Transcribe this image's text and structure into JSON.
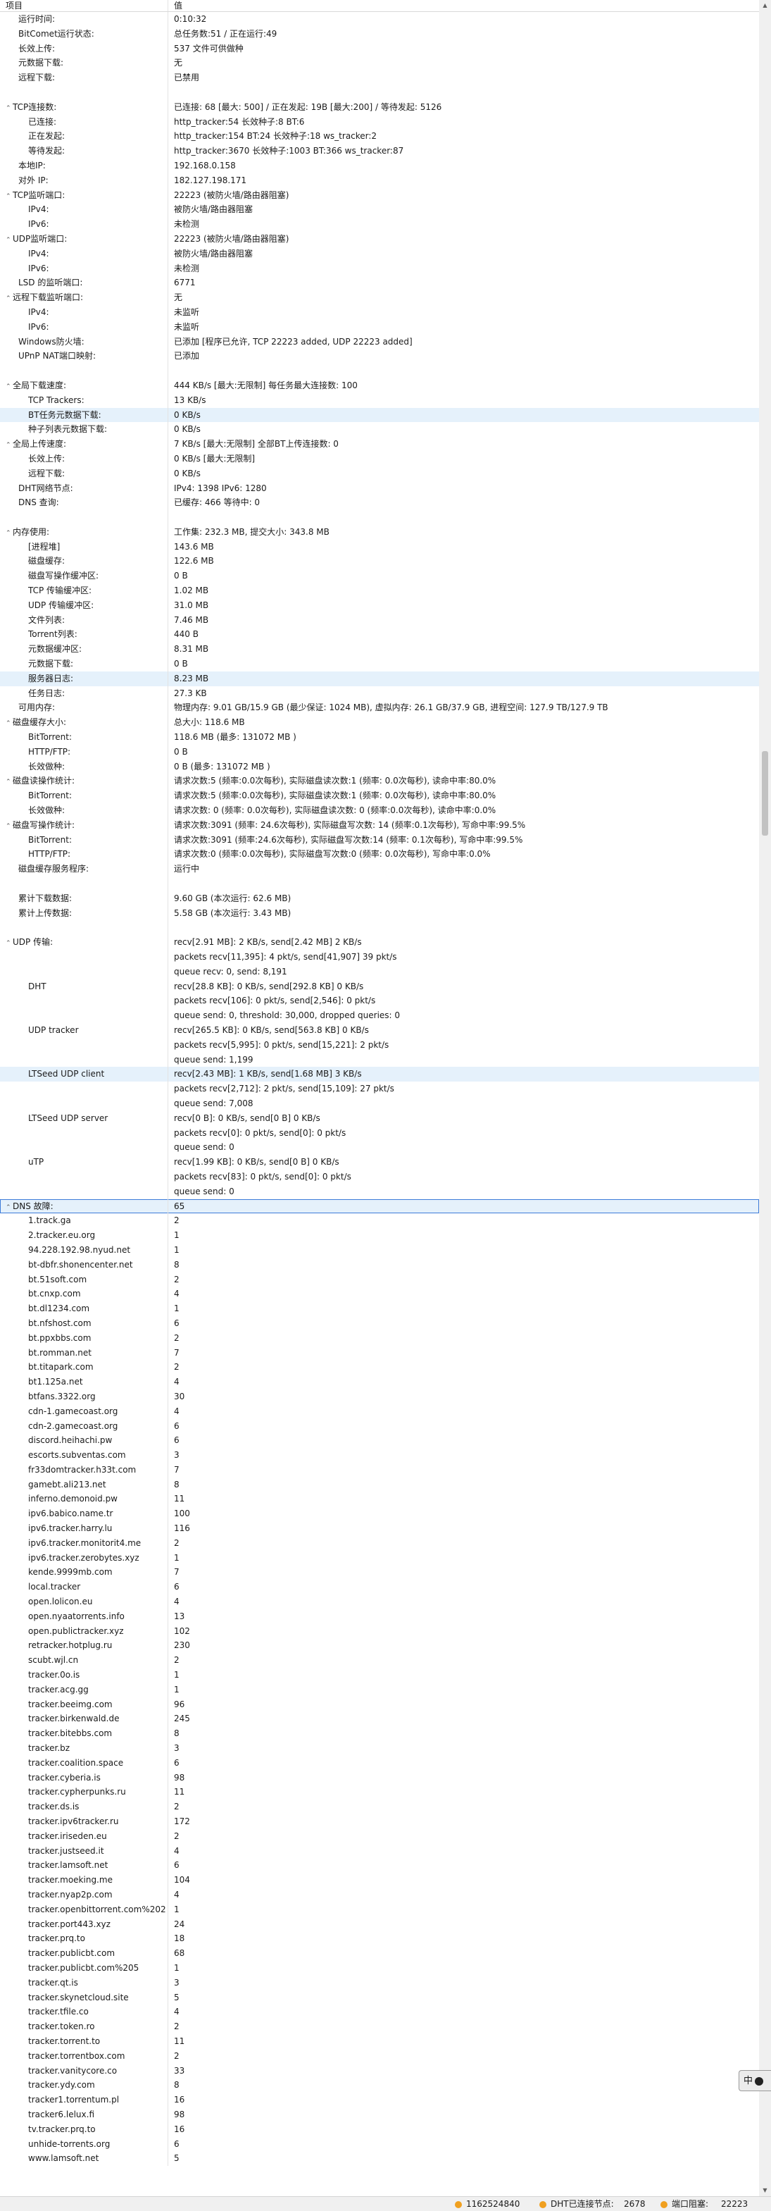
{
  "header": {
    "col_item": "项目",
    "col_value": "值"
  },
  "rows": [
    {
      "k": "运行时间:",
      "v": "0:10:32",
      "i": 1
    },
    {
      "k": "BitComet运行状态:",
      "v": "总任务数:51 / 正在运行:49",
      "i": 1
    },
    {
      "k": "长效上传:",
      "v": "537 文件可供做种",
      "i": 1
    },
    {
      "k": "元数据下载:",
      "v": "无",
      "i": 1
    },
    {
      "k": "远程下载:",
      "v": "已禁用",
      "i": 1
    },
    {
      "k": "",
      "v": ""
    },
    {
      "k": "TCP连接数:",
      "v": "已连接: 68 [最大: 500] / 正在发起: 19B [最大:200] / 等待发起: 5126",
      "t": "^"
    },
    {
      "k": "已连接:",
      "v": "http_tracker:54  长效种子:8  BT:6",
      "i": 2
    },
    {
      "k": "正在发起:",
      "v": "http_tracker:154  BT:24  长效种子:18  ws_tracker:2",
      "i": 2
    },
    {
      "k": "等待发起:",
      "v": "http_tracker:3670  长效种子:1003  BT:366  ws_tracker:87",
      "i": 2
    },
    {
      "k": "本地IP:",
      "v": "192.168.0.158",
      "i": 1
    },
    {
      "k": "对外 IP:",
      "v": "182.127.198.171",
      "i": 1
    },
    {
      "k": "TCP监听端口:",
      "v": "22223 (被防火墙/路由器阻塞)",
      "t": "^"
    },
    {
      "k": "IPv4:",
      "v": "被防火墙/路由器阻塞",
      "i": 2
    },
    {
      "k": "IPv6:",
      "v": "未检测",
      "i": 2
    },
    {
      "k": "UDP监听端口:",
      "v": "22223 (被防火墙/路由器阻塞)",
      "t": "^"
    },
    {
      "k": "IPv4:",
      "v": "被防火墙/路由器阻塞",
      "i": 2
    },
    {
      "k": "IPv6:",
      "v": "未检测",
      "i": 2
    },
    {
      "k": "LSD 的监听端口:",
      "v": "6771",
      "i": 1
    },
    {
      "k": "远程下载监听端口:",
      "v": "无",
      "t": "^"
    },
    {
      "k": "IPv4:",
      "v": "未监听",
      "i": 2
    },
    {
      "k": "IPv6:",
      "v": "未监听",
      "i": 2
    },
    {
      "k": "Windows防火墙:",
      "v": "已添加 [程序已允许, TCP 22223 added, UDP 22223 added]",
      "i": 1
    },
    {
      "k": "UPnP NAT端口映射:",
      "v": "已添加",
      "i": 1
    },
    {
      "k": "",
      "v": ""
    },
    {
      "k": "全局下载速度:",
      "v": "444 KB/s [最大:无限制]      每任务最大连接数: 100",
      "t": "^"
    },
    {
      "k": "TCP Trackers:",
      "v": "13 KB/s",
      "i": 2
    },
    {
      "k": "BT任务元数据下载:",
      "v": "0 KB/s",
      "i": 2,
      "hl": 1
    },
    {
      "k": "种子列表元数据下载:",
      "v": "0 KB/s",
      "i": 2
    },
    {
      "k": "全局上传速度:",
      "v": "7 KB/s [最大:无限制]      全部BT上传连接数: 0",
      "t": "^"
    },
    {
      "k": "长效上传:",
      "v": "0 KB/s [最大:无限制]",
      "i": 2
    },
    {
      "k": "远程下载:",
      "v": "0 KB/s",
      "i": 2
    },
    {
      "k": "DHT网络节点:",
      "v": "IPv4: 1398  IPv6: 1280",
      "i": 1
    },
    {
      "k": "DNS 查询:",
      "v": "已缓存:   466    等待中:   0",
      "i": 1
    },
    {
      "k": "",
      "v": ""
    },
    {
      "k": "内存使用:",
      "v": "工作集: 232.3 MB, 提交大小: 343.8 MB",
      "t": "^"
    },
    {
      "k": "[进程堆]",
      "v": "143.6 MB",
      "i": 2
    },
    {
      "k": "磁盘缓存:",
      "v": "122.6 MB",
      "i": 2
    },
    {
      "k": "磁盘写操作缓冲区:",
      "v": "0 B",
      "i": 2
    },
    {
      "k": "TCP 传输缓冲区:",
      "v": "1.02 MB",
      "i": 2
    },
    {
      "k": "UDP 传输缓冲区:",
      "v": "31.0 MB",
      "i": 2
    },
    {
      "k": "文件列表:",
      "v": "7.46 MB",
      "i": 2
    },
    {
      "k": "Torrent列表:",
      "v": "440 B",
      "i": 2
    },
    {
      "k": "元数据缓冲区:",
      "v": "8.31 MB",
      "i": 2
    },
    {
      "k": "元数据下载:",
      "v": "0 B",
      "i": 2
    },
    {
      "k": "服务器日志:",
      "v": "8.23 MB",
      "i": 2,
      "hl": 1
    },
    {
      "k": "任务日志:",
      "v": "27.3 KB",
      "i": 2
    },
    {
      "k": "可用内存:",
      "v": "物理内存: 9.01 GB/15.9 GB (最少保证: 1024 MB), 虚拟内存: 26.1 GB/37.9 GB, 进程空间: 127.9 TB/127.9 TB",
      "i": 1
    },
    {
      "k": "磁盘缓存大小:",
      "v": "总大小: 118.6 MB",
      "t": "^"
    },
    {
      "k": "BitTorrent:",
      "v": "118.6 MB (最多: 131072 MB )",
      "i": 2
    },
    {
      "k": "HTTP/FTP:",
      "v": "0 B",
      "i": 2
    },
    {
      "k": "长效做种:",
      "v": "0 B (最多: 131072 MB )",
      "i": 2
    },
    {
      "k": "磁盘读操作统计:",
      "v": "请求次数:5 (频率:0.0次每秒), 实际磁盘读次数:1 (频率: 0.0次每秒), 读命中率:80.0%",
      "t": "^"
    },
    {
      "k": "BitTorrent:",
      "v": "请求次数:5 (频率:0.0次每秒), 实际磁盘读次数:1 (频率: 0.0次每秒), 读命中率:80.0%",
      "i": 2
    },
    {
      "k": "长效做种:",
      "v": "请求次数: 0 (频率: 0.0次每秒), 实际磁盘读次数: 0 (频率:0.0次每秒), 读命中率:0.0%",
      "i": 2
    },
    {
      "k": "磁盘写操作统计:",
      "v": "请求次数:3091 (频率: 24.6次每秒), 实际磁盘写次数: 14 (频率:0.1次每秒), 写命中率:99.5%",
      "t": "^"
    },
    {
      "k": "BitTorrent:",
      "v": "请求次数:3091 (频率:24.6次每秒), 实际磁盘写次数:14 (频率: 0.1次每秒), 写命中率:99.5%",
      "i": 2
    },
    {
      "k": "HTTP/FTP:",
      "v": "请求次数:0 (频率:0.0次每秒), 实际磁盘写次数:0 (频率: 0.0次每秒), 写命中率:0.0%",
      "i": 2
    },
    {
      "k": "磁盘缓存服务程序:",
      "v": "运行中",
      "i": 1
    },
    {
      "k": "",
      "v": ""
    },
    {
      "k": "累计下载数据:",
      "v": "9.60 GB (本次运行: 62.6 MB)",
      "i": 1
    },
    {
      "k": "累计上传数据:",
      "v": "5.58 GB (本次运行: 3.43 MB)",
      "i": 1
    },
    {
      "k": "",
      "v": ""
    },
    {
      "k": "UDP 传输:",
      "v": "recv[2.91 MB]: 2 KB/s, send[2.42 MB] 2 KB/s",
      "t": "^"
    },
    {
      "k": "",
      "v": "packets recv[11,395]: 4 pkt/s, send[41,907] 39 pkt/s"
    },
    {
      "k": "",
      "v": "queue recv: 0, send: 8,191"
    },
    {
      "k": "DHT",
      "v": "recv[28.8 KB]: 0 KB/s, send[292.8 KB] 0 KB/s",
      "i": 2
    },
    {
      "k": "",
      "v": "packets recv[106]: 0 pkt/s, send[2,546]: 0 pkt/s"
    },
    {
      "k": "",
      "v": "queue send: 0, threshold: 30,000, dropped queries: 0"
    },
    {
      "k": "UDP tracker",
      "v": "recv[265.5 KB]: 0 KB/s, send[563.8 KB] 0 KB/s",
      "i": 2
    },
    {
      "k": "",
      "v": "packets recv[5,995]: 0 pkt/s, send[15,221]: 2 pkt/s"
    },
    {
      "k": "",
      "v": "queue send: 1,199"
    },
    {
      "k": "LTSeed UDP client",
      "v": "recv[2.43 MB]: 1 KB/s, send[1.68 MB] 3 KB/s",
      "i": 2,
      "hl": 1
    },
    {
      "k": "",
      "v": "packets recv[2,712]: 2 pkt/s, send[15,109]: 27 pkt/s"
    },
    {
      "k": "",
      "v": "queue send: 7,008"
    },
    {
      "k": "LTSeed UDP server",
      "v": "recv[0 B]: 0 KB/s, send[0 B] 0 KB/s",
      "i": 2
    },
    {
      "k": "",
      "v": "packets recv[0]: 0 pkt/s, send[0]: 0 pkt/s"
    },
    {
      "k": "",
      "v": "queue send: 0"
    },
    {
      "k": "uTP",
      "v": "recv[1.99 KB]: 0 KB/s, send[0 B] 0 KB/s",
      "i": 2
    },
    {
      "k": "",
      "v": "packets recv[83]: 0 pkt/s, send[0]: 0 pkt/s"
    },
    {
      "k": "",
      "v": "queue send: 0"
    },
    {
      "k": "DNS 故障:",
      "v": "65",
      "t": "^",
      "sel": 1
    },
    {
      "k": "1.track.ga",
      "v": "2",
      "i": 2
    },
    {
      "k": "2.tracker.eu.org",
      "v": "1",
      "i": 2
    },
    {
      "k": "94.228.192.98.nyud.net",
      "v": "1",
      "i": 2
    },
    {
      "k": "bt-dbfr.shonencenter.net",
      "v": "8",
      "i": 2
    },
    {
      "k": "bt.51soft.com",
      "v": "2",
      "i": 2
    },
    {
      "k": "bt.cnxp.com",
      "v": "4",
      "i": 2
    },
    {
      "k": "bt.dl1234.com",
      "v": "1",
      "i": 2
    },
    {
      "k": "bt.nfshost.com",
      "v": "6",
      "i": 2
    },
    {
      "k": "bt.ppxbbs.com",
      "v": "2",
      "i": 2
    },
    {
      "k": "bt.romman.net",
      "v": "7",
      "i": 2
    },
    {
      "k": "bt.titapark.com",
      "v": "2",
      "i": 2
    },
    {
      "k": "bt1.125a.net",
      "v": "4",
      "i": 2
    },
    {
      "k": "btfans.3322.org",
      "v": "30",
      "i": 2
    },
    {
      "k": "cdn-1.gamecoast.org",
      "v": "4",
      "i": 2
    },
    {
      "k": "cdn-2.gamecoast.org",
      "v": "6",
      "i": 2
    },
    {
      "k": "discord.heihachi.pw",
      "v": "6",
      "i": 2
    },
    {
      "k": "escorts.subventas.com",
      "v": "3",
      "i": 2
    },
    {
      "k": "fr33domtracker.h33t.com",
      "v": "7",
      "i": 2
    },
    {
      "k": "gamebt.ali213.net",
      "v": "8",
      "i": 2
    },
    {
      "k": "inferno.demonoid.pw",
      "v": "11",
      "i": 2
    },
    {
      "k": "ipv6.babico.name.tr",
      "v": "100",
      "i": 2
    },
    {
      "k": "ipv6.tracker.harry.lu",
      "v": "116",
      "i": 2
    },
    {
      "k": "ipv6.tracker.monitorit4.me",
      "v": "2",
      "i": 2
    },
    {
      "k": "ipv6.tracker.zerobytes.xyz",
      "v": "1",
      "i": 2
    },
    {
      "k": "kende.9999mb.com",
      "v": "7",
      "i": 2
    },
    {
      "k": "local.tracker",
      "v": "6",
      "i": 2
    },
    {
      "k": "open.lolicon.eu",
      "v": "4",
      "i": 2
    },
    {
      "k": "open.nyaatorrents.info",
      "v": "13",
      "i": 2
    },
    {
      "k": "open.publictracker.xyz",
      "v": "102",
      "i": 2
    },
    {
      "k": "retracker.hotplug.ru",
      "v": "230",
      "i": 2
    },
    {
      "k": "scubt.wjl.cn",
      "v": "2",
      "i": 2
    },
    {
      "k": "tracker.0o.is",
      "v": "1",
      "i": 2
    },
    {
      "k": "tracker.acg.gg",
      "v": "1",
      "i": 2
    },
    {
      "k": "tracker.beeimg.com",
      "v": "96",
      "i": 2
    },
    {
      "k": "tracker.birkenwald.de",
      "v": "245",
      "i": 2
    },
    {
      "k": "tracker.bitebbs.com",
      "v": "8",
      "i": 2
    },
    {
      "k": "tracker.bz",
      "v": "3",
      "i": 2
    },
    {
      "k": "tracker.coalition.space",
      "v": "6",
      "i": 2
    },
    {
      "k": "tracker.cyberia.is",
      "v": "98",
      "i": 2
    },
    {
      "k": "tracker.cypherpunks.ru",
      "v": "11",
      "i": 2
    },
    {
      "k": "tracker.ds.is",
      "v": "2",
      "i": 2
    },
    {
      "k": "tracker.ipv6tracker.ru",
      "v": "172",
      "i": 2
    },
    {
      "k": "tracker.iriseden.eu",
      "v": "2",
      "i": 2
    },
    {
      "k": "tracker.justseed.it",
      "v": "4",
      "i": 2
    },
    {
      "k": "tracker.lamsoft.net",
      "v": "6",
      "i": 2
    },
    {
      "k": "tracker.moeking.me",
      "v": "104",
      "i": 2
    },
    {
      "k": "tracker.nyap2p.com",
      "v": "4",
      "i": 2
    },
    {
      "k": "tracker.openbittorrent.com%202",
      "v": "1",
      "i": 2
    },
    {
      "k": "tracker.port443.xyz",
      "v": "24",
      "i": 2
    },
    {
      "k": "tracker.prq.to",
      "v": "18",
      "i": 2
    },
    {
      "k": "tracker.publicbt.com",
      "v": "68",
      "i": 2
    },
    {
      "k": "tracker.publicbt.com%205",
      "v": "1",
      "i": 2
    },
    {
      "k": "tracker.qt.is",
      "v": "3",
      "i": 2
    },
    {
      "k": "tracker.skynetcloud.site",
      "v": "5",
      "i": 2
    },
    {
      "k": "tracker.tfile.co",
      "v": "4",
      "i": 2
    },
    {
      "k": "tracker.token.ro",
      "v": "2",
      "i": 2
    },
    {
      "k": "tracker.torrent.to",
      "v": "11",
      "i": 2
    },
    {
      "k": "tracker.torrentbox.com",
      "v": "2",
      "i": 2
    },
    {
      "k": "tracker.vanitycore.co",
      "v": "33",
      "i": 2
    },
    {
      "k": "tracker.ydy.com",
      "v": "8",
      "i": 2
    },
    {
      "k": "tracker1.torrentum.pl",
      "v": "16",
      "i": 2
    },
    {
      "k": "tracker6.lelux.fi",
      "v": "98",
      "i": 2
    },
    {
      "k": "tv.tracker.prq.to",
      "v": "16",
      "i": 2
    },
    {
      "k": "unhide-torrents.org",
      "v": "6",
      "i": 2
    },
    {
      "k": "www.lamsoft.net",
      "v": "5",
      "i": 2
    }
  ],
  "statusbar": {
    "id_value": "1162524840",
    "dht_label": "DHT已连接节点:",
    "dht_value": "2678",
    "port_label": "端口阻塞:",
    "port_value": "22223"
  },
  "ime": {
    "label": "中"
  },
  "colors": {
    "selected_row": "#e5f1fb",
    "selected_border": "#3d7bd9",
    "status_dot": "#f0a020"
  }
}
